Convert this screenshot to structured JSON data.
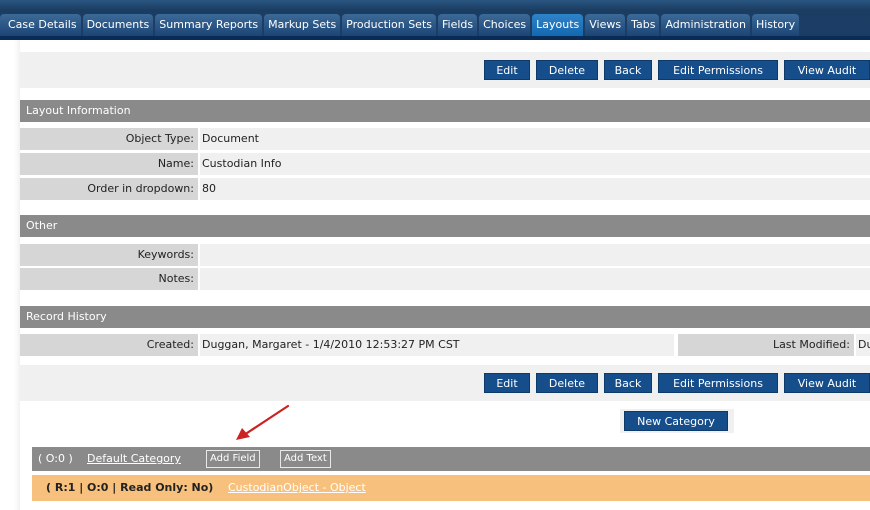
{
  "tabs": [
    {
      "label": "Case Details"
    },
    {
      "label": "Documents"
    },
    {
      "label": "Summary Reports"
    },
    {
      "label": "Markup Sets"
    },
    {
      "label": "Production Sets"
    },
    {
      "label": "Fields"
    },
    {
      "label": "Choices"
    },
    {
      "label": "Layouts"
    },
    {
      "label": "Views"
    },
    {
      "label": "Tabs"
    },
    {
      "label": "Administration"
    },
    {
      "label": "History"
    }
  ],
  "active_tab": "Layouts",
  "toolbar": {
    "edit": "Edit",
    "delete": "Delete",
    "back": "Back",
    "edit_permissions": "Edit Permissions",
    "view_audit": "View Audit"
  },
  "layout_info": {
    "title": "Layout Information",
    "object_type_label": "Object Type:",
    "object_type_value": "Document",
    "name_label": "Name:",
    "name_value": "Custodian Info",
    "order_label": "Order in dropdown:",
    "order_value": "80"
  },
  "other": {
    "title": "Other",
    "keywords_label": "Keywords:",
    "keywords_value": "",
    "notes_label": "Notes:",
    "notes_value": ""
  },
  "record_history": {
    "title": "Record History",
    "created_label": "Created:",
    "created_value": "Duggan, Margaret - 1/4/2010 12:53:27 PM CST",
    "last_modified_label": "Last Modified:",
    "last_modified_value": "Du"
  },
  "new_category": "New Category",
  "category": {
    "count": "( O:0 )",
    "name": "Default Category",
    "add_field": "Add Field",
    "add_text": "Add Text"
  },
  "field": {
    "meta": "( R:1 | O:0 | Read Only: No)",
    "name": "CustodianObject - Object"
  },
  "colors": {
    "tabbar": "#1c3e66",
    "active_tab": "#1b72bd",
    "button": "#164e8c",
    "header_band": "#8a8a8a",
    "field_row": "#f7c17d",
    "arrow": "#cc2222"
  }
}
